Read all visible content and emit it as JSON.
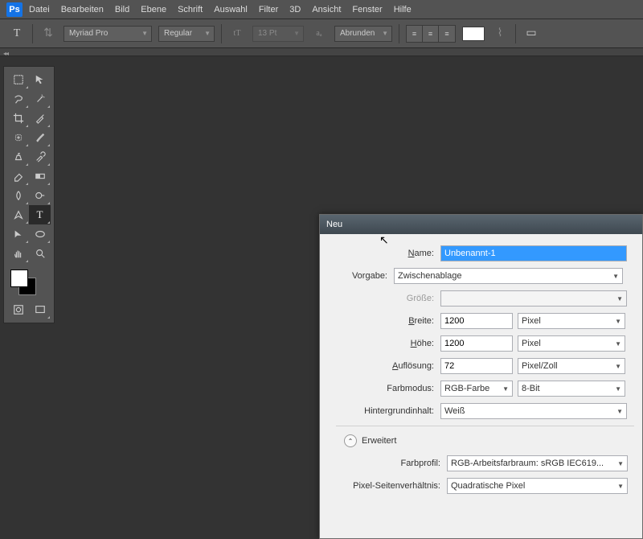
{
  "menubar": {
    "items": [
      "Datei",
      "Bearbeiten",
      "Bild",
      "Ebene",
      "Schrift",
      "Auswahl",
      "Filter",
      "3D",
      "Ansicht",
      "Fenster",
      "Hilfe"
    ]
  },
  "optbar": {
    "font": "Myriad Pro",
    "style": "Regular",
    "size": "13 Pt",
    "aa": "Abrunden"
  },
  "dialog": {
    "title": "Neu",
    "name_lbl": "Name:",
    "name_val": "Unbenannt-1",
    "preset_lbl": "Vorgabe:",
    "preset_val": "Zwischenablage",
    "size_lbl": "Größe:",
    "width_lbl": "Breite:",
    "width_val": "1200",
    "width_unit": "Pixel",
    "height_lbl": "Höhe:",
    "height_val": "1200",
    "height_unit": "Pixel",
    "res_lbl": "Auflösung:",
    "res_val": "72",
    "res_unit": "Pixel/Zoll",
    "mode_lbl": "Farbmodus:",
    "mode_val": "RGB-Farbe",
    "depth_val": "8-Bit",
    "bg_lbl": "Hintergrundinhalt:",
    "bg_val": "Weiß",
    "advanced": "Erweitert",
    "profile_lbl": "Farbprofil:",
    "profile_val": "RGB-Arbeitsfarbraum:  sRGB IEC619...",
    "aspect_lbl": "Pixel-Seitenverhältnis:",
    "aspect_val": "Quadratische Pixel"
  }
}
